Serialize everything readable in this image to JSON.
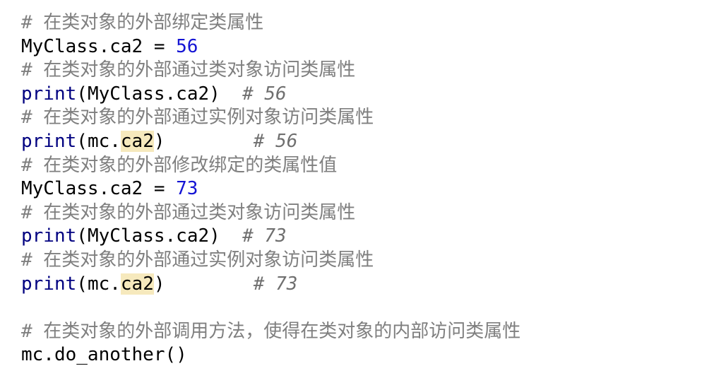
{
  "lines": [
    {
      "kind": "comment",
      "text": "# 在类对象的外部绑定类属性"
    },
    {
      "kind": "assign",
      "target": "MyClass.ca2",
      "op": " = ",
      "value": "56"
    },
    {
      "kind": "comment",
      "text": "# 在类对象的外部通过类对象访问类属性"
    },
    {
      "kind": "print",
      "func": "print",
      "open": "(",
      "prefix": "MyClass.ca2",
      "highlight": "",
      "close": ")",
      "pad": "  ",
      "comment": "# 56"
    },
    {
      "kind": "comment",
      "text": "# 在类对象的外部通过实例对象访问类属性"
    },
    {
      "kind": "print",
      "func": "print",
      "open": "(",
      "prefix": "mc.",
      "highlight": "ca2",
      "close": ")",
      "pad": "        ",
      "comment": "# 56"
    },
    {
      "kind": "comment",
      "text": "# 在类对象的外部修改绑定的类属性值"
    },
    {
      "kind": "assign",
      "target": "MyClass.ca2",
      "op": " = ",
      "value": "73"
    },
    {
      "kind": "comment",
      "text": "# 在类对象的外部通过类对象访问类属性"
    },
    {
      "kind": "print",
      "func": "print",
      "open": "(",
      "prefix": "MyClass.ca2",
      "highlight": "",
      "close": ")",
      "pad": "  ",
      "comment": "# 73"
    },
    {
      "kind": "comment",
      "text": "# 在类对象的外部通过实例对象访问类属性"
    },
    {
      "kind": "print",
      "func": "print",
      "open": "(",
      "prefix": "mc.",
      "highlight": "ca2",
      "close": ")",
      "pad": "        ",
      "comment": "# 73"
    },
    {
      "kind": "blank",
      "text": ""
    },
    {
      "kind": "comment",
      "text": "# 在类对象的外部调用方法，使得在类对象的内部访问类属性"
    },
    {
      "kind": "plain",
      "text": "mc.do_another()"
    }
  ]
}
